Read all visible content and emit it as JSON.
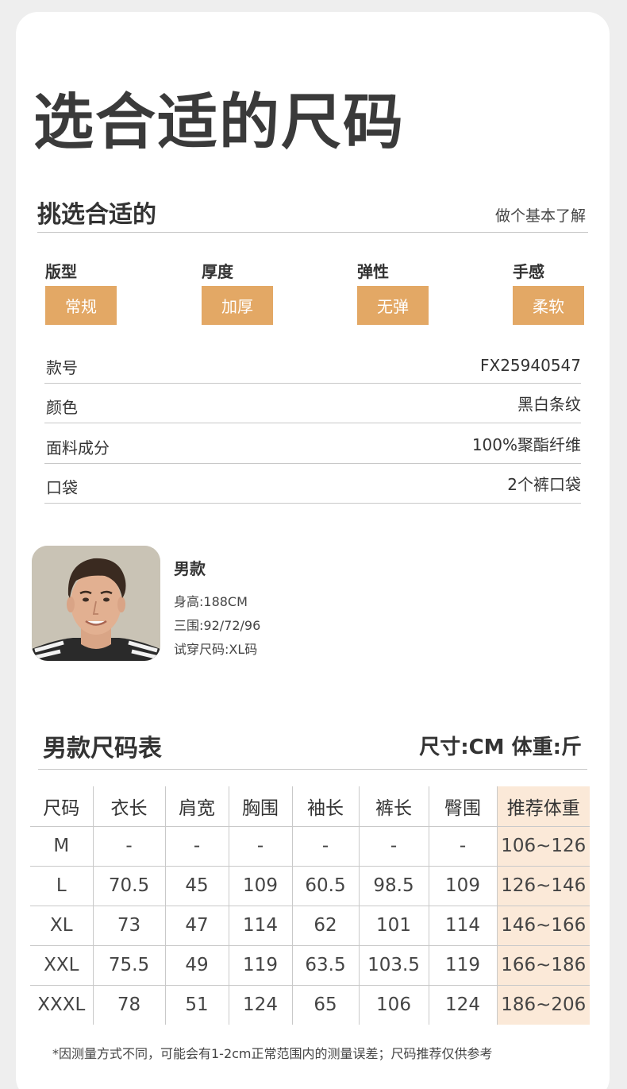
{
  "title": "选合适的尺码",
  "pick_section": {
    "heading": "挑选合适的",
    "subtitle": "做个基本了解"
  },
  "attributes": [
    {
      "label": "版型",
      "value": "常规"
    },
    {
      "label": "厚度",
      "value": "加厚"
    },
    {
      "label": "弹性",
      "value": "无弹"
    },
    {
      "label": "手感",
      "value": "柔软"
    }
  ],
  "specs": [
    {
      "key": "款号",
      "value": "FX25940547"
    },
    {
      "key": "颜色",
      "value": "黑白条纹"
    },
    {
      "key": "面料成分",
      "value": "100%聚酯纤维"
    },
    {
      "key": "口袋",
      "value": "2个裤口袋"
    }
  ],
  "model": {
    "name": "男款",
    "height": "身高:188CM",
    "measurements": "三围:92/72/96",
    "try_size": "试穿尺码:XL码"
  },
  "size_chart": {
    "heading": "男款尺码表",
    "units": "尺寸:CM 体重:斤",
    "columns": [
      "尺码",
      "衣长",
      "肩宽",
      "胸围",
      "袖长",
      "裤长",
      "臀围",
      "推荐体重"
    ],
    "rows": [
      [
        "M",
        "-",
        "-",
        "-",
        "-",
        "-",
        "-",
        "106~126"
      ],
      [
        "L",
        "70.5",
        "45",
        "109",
        "60.5",
        "98.5",
        "109",
        "126~146"
      ],
      [
        "XL",
        "73",
        "47",
        "114",
        "62",
        "101",
        "114",
        "146~166"
      ],
      [
        "XXL",
        "75.5",
        "49",
        "119",
        "63.5",
        "103.5",
        "119",
        "166~186"
      ],
      [
        "XXXL",
        "78",
        "51",
        "124",
        "65",
        "106",
        "124",
        "186~206"
      ]
    ]
  },
  "note": "*因测量方式不同，可能会有1-2cm正常范围内的测量误差；尺码推荐仅供参考",
  "colors": {
    "accent": "#e3a865",
    "highlight_column": "#fbe9d8"
  }
}
